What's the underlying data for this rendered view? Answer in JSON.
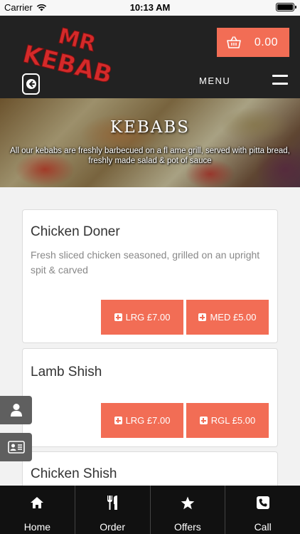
{
  "status_bar": {
    "carrier": "Carrier",
    "time": "10:13 AM"
  },
  "header": {
    "logo_text": "MR KEBAB",
    "cart_amount": "0.00",
    "menu_label": "MENU"
  },
  "banner": {
    "title": "KEBABS",
    "description": "All our kebabs are freshly barbecued on a fl ame grill, served with pitta bread, freshly made salad & pot of sauce"
  },
  "items": [
    {
      "name": "Chicken Doner",
      "description": "Fresh sliced chicken seasoned, grilled on an upright spit & carved",
      "options": [
        {
          "label": "LRG £7.00"
        },
        {
          "label": "MED £5.00"
        }
      ]
    },
    {
      "name": "Lamb Shish",
      "description": "",
      "options": [
        {
          "label": "LRG £7.00"
        },
        {
          "label": "RGL £5.00"
        }
      ]
    },
    {
      "name": "Chicken Shish"
    }
  ],
  "side_tabs": [
    {
      "icon": "user-icon"
    },
    {
      "icon": "contact-card-icon"
    }
  ],
  "bottom_nav": [
    {
      "label": "Home",
      "icon": "home-icon"
    },
    {
      "label": "Order",
      "icon": "fork-knife-icon"
    },
    {
      "label": "Offers",
      "icon": "star-icon"
    },
    {
      "label": "Call",
      "icon": "phone-icon"
    }
  ],
  "colors": {
    "accent": "#f26d55",
    "header_bg": "#222222",
    "logo_red": "#d42a2a",
    "nav_bg": "#111111"
  }
}
